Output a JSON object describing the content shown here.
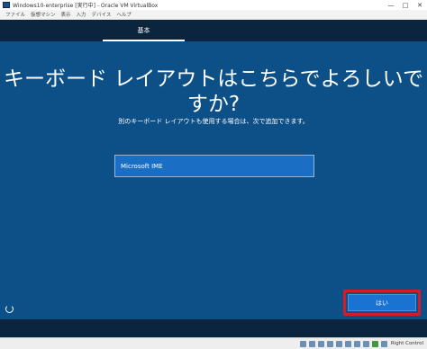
{
  "window": {
    "title": "Windows10-enterprise [実行中] - Oracle VM VirtualBox",
    "controls": {
      "minimize": "—",
      "maximize": "□",
      "close": "✕"
    }
  },
  "menubar": {
    "items": [
      "ファイル",
      "仮想マシン",
      "表示",
      "入力",
      "デバイス",
      "ヘルプ"
    ]
  },
  "setup": {
    "tab_label": "基本",
    "heading_line1": "キーボード レイアウトはこちらでよろしいで",
    "heading_line2": "すか?",
    "subtext": "別のキーボード レイアウトも使用する場合は、次で追加できます。",
    "layout_item": "Microsoft IME",
    "yes_label": "はい",
    "accessibility_icon": "accessibility-icon"
  },
  "statusbar": {
    "icons": [
      "hdd-icon",
      "optical-drive-icon",
      "audio-icon",
      "network-icon",
      "usb-icon",
      "shared-folder-icon",
      "display-icon",
      "recording-icon",
      "cpu-icon",
      "mouse-integration-icon"
    ],
    "host_key_label": "Right Control"
  },
  "colors": {
    "setup_background": "#0d4f87",
    "dark_strip": "#0b253e",
    "selected_item": "#1a6fc4",
    "yes_button": "#1a73d1",
    "highlight_box": "#d51a2a"
  }
}
